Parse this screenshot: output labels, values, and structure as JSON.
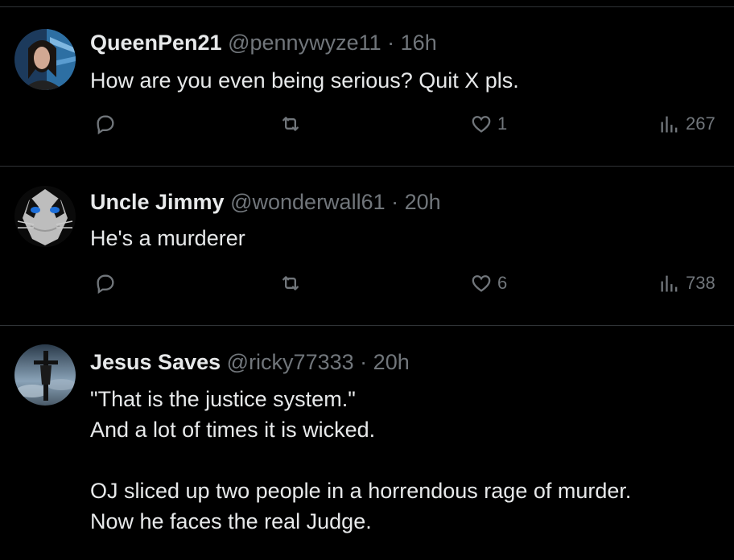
{
  "tweets": [
    {
      "name": "QueenPen21",
      "handle": "@pennywyze11",
      "separator": "·",
      "time": "16h",
      "lines": [
        "How are you even being serious? Quit X pls."
      ],
      "likes": "1",
      "views": "267",
      "icons": {
        "reply": "reply-icon",
        "retweet": "retweet-icon",
        "like": "heart-icon",
        "views": "views-icon"
      }
    },
    {
      "name": "Uncle Jimmy",
      "handle": "@wonderwall61",
      "separator": "·",
      "time": "20h",
      "lines": [
        "He's a murderer"
      ],
      "likes": "6",
      "views": "738",
      "icons": {
        "reply": "reply-icon",
        "retweet": "retweet-icon",
        "like": "heart-icon",
        "views": "views-icon"
      }
    },
    {
      "name": "Jesus Saves",
      "handle": "@ricky77333",
      "separator": "·",
      "time": "20h",
      "lines": [
        "\"That is the justice system.\"",
        "And a lot of times it is wicked.",
        "",
        "OJ sliced up two people in a horrendous rage of murder.",
        "Now he faces the real Judge."
      ]
    }
  ],
  "colors": {
    "background": "#000000",
    "text": "#e7e9ea",
    "muted": "#71767b",
    "divider": "#2f3336"
  }
}
